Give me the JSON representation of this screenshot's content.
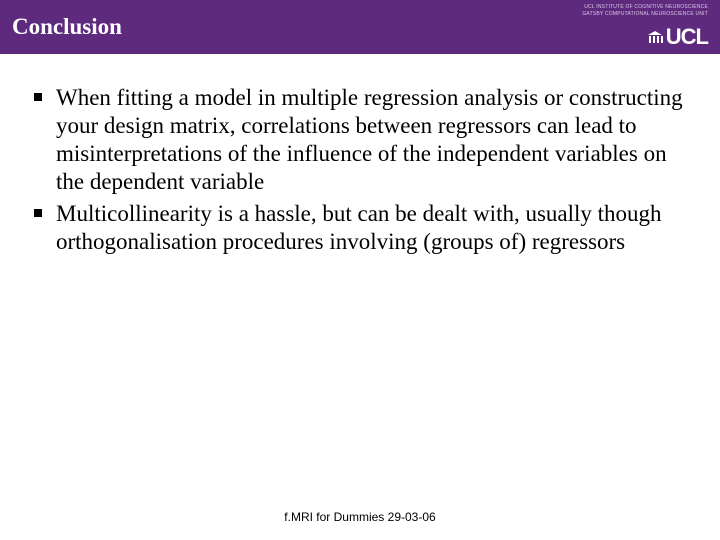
{
  "header": {
    "title": "Conclusion",
    "affiliation_line1": "UCL INSTITUTE OF COGNITIVE NEUROSCIENCE",
    "affiliation_line2": "GATSBY COMPUTATIONAL NEUROSCIENCE UNIT",
    "logo_text": "UCL"
  },
  "bullets": [
    "When fitting a model in multiple regression analysis or constructing your design matrix, correlations between regressors can lead to misinterpretations of the influence of the independent variables on the dependent variable",
    "Multicollinearity is a hassle, but can be dealt with, usually though orthogonalisation procedures involving (groups of) regressors"
  ],
  "footer": "f.MRI for Dummies 29-03-06"
}
